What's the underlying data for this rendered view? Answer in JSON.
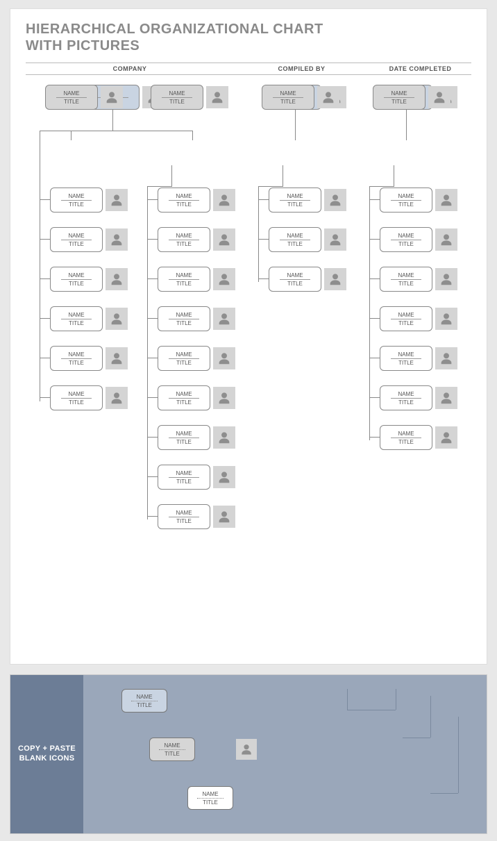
{
  "title_line1": "HIERARCHICAL ORGANIZATIONAL CHART",
  "title_line2": "WITH PICTURES",
  "headers": {
    "company": "COMPANY",
    "compiled": "COMPILED BY",
    "date": "DATE COMPLETED"
  },
  "labels": {
    "name": "NAME",
    "title": "TITLE"
  },
  "copy_paste": {
    "side_line1": "COPY + PASTE",
    "side_line2": "BLANK ICONS"
  },
  "chart_data": {
    "type": "diagram",
    "title": "Hierarchical Organizational Chart With Pictures",
    "notes": "Template with placeholder NAME/TITLE cards and avatar pictures; four branches.",
    "branches": [
      {
        "id": "A",
        "top": {
          "color": "blue"
        },
        "managers": 1,
        "manager_color": "grey",
        "children_per_manager": [
          6
        ]
      },
      {
        "id": "B_under_A_top",
        "managers": 1,
        "manager_color": "grey",
        "children_per_manager": [
          9
        ]
      },
      {
        "id": "C",
        "top": {
          "color": "blue"
        },
        "managers": 1,
        "manager_color": "grey",
        "children_per_manager": [
          3
        ]
      },
      {
        "id": "D",
        "top": {
          "color": "blue"
        },
        "managers": 1,
        "manager_color": "grey",
        "children_per_manager": [
          7
        ]
      }
    ],
    "copy_paste_samples": [
      "blue-card",
      "grey-card",
      "white-card",
      "avatar",
      "connector-lines"
    ]
  }
}
